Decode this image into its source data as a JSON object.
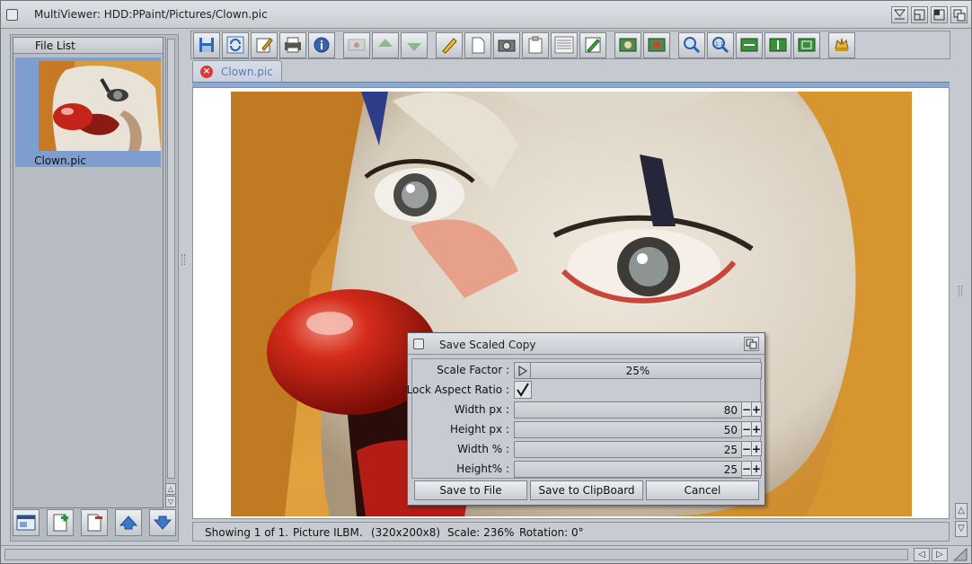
{
  "window": {
    "title": "MultiViewer: HDD:PPaint/Pictures/Clown.pic"
  },
  "filelist": {
    "header": "File List",
    "items": [
      {
        "name": "Clown.pic",
        "selected": true
      }
    ]
  },
  "toolbar": {
    "buttons": [
      "save-icon",
      "reload-icon",
      "edit-icon",
      "print-icon",
      "info-icon",
      "slideshow-icon",
      "previous-icon",
      "next-icon",
      "pencil-icon",
      "new-page-icon",
      "camera-icon",
      "clipboard-icon",
      "fonts-icon",
      "paint-icon",
      "rotate-left-icon",
      "rotate-right-icon",
      "zoom-in-icon",
      "zoom-1-1-icon",
      "flip-horizontal-icon",
      "flip-vertical-icon",
      "crop-icon",
      "settings-icon"
    ]
  },
  "tab": {
    "label": "Clown.pic"
  },
  "status": {
    "showing": "Showing 1 of 1.",
    "format": "Picture ILBM.",
    "dimensions": "(320x200x8)",
    "scale": "Scale: 236%",
    "rotation": "Rotation: 0°"
  },
  "dialog": {
    "title": "Save Scaled Copy",
    "scale_factor": {
      "label": "Scale Factor :",
      "value": "25%"
    },
    "lock_aspect": {
      "label": "Lock Aspect Ratio :",
      "checked": true
    },
    "width_px": {
      "label": "Width px :",
      "value": "80"
    },
    "height_px": {
      "label": "Height px :",
      "value": "50"
    },
    "width_pct": {
      "label": "Width % :",
      "value": "25"
    },
    "height_pct": {
      "label": "Height% :",
      "value": "25"
    },
    "buttons": {
      "save_file": "Save to File",
      "save_clipboard": "Save to ClipBoard",
      "cancel": "Cancel"
    }
  },
  "colors": {
    "accent": "#7f9ed0",
    "tab_text": "#5a7bb7",
    "window_bg": "#c6cad0"
  }
}
